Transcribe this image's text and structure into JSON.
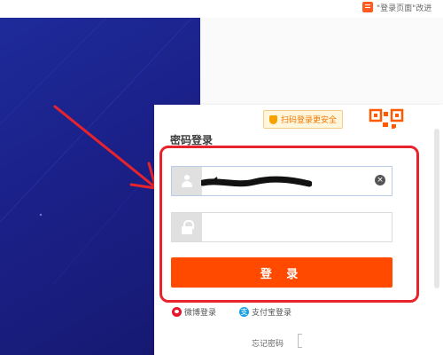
{
  "header": {
    "feedback_text": "\"登录页面\"改进"
  },
  "login": {
    "title": "密码登录",
    "qr_tip": "扫码登录更安全",
    "username_value": "",
    "password_value": "",
    "clear_symbol": "×",
    "submit_label": "登 录",
    "alt_logins": {
      "weibo": "微博登录",
      "alipay": "支付宝登录"
    },
    "forgot_password": "忘记密码"
  },
  "colors": {
    "primary_button": "#ff4a00",
    "hero_background": "#1b218a",
    "annotation_red": "#e8232b",
    "qr_tip_text": "#f07800"
  },
  "icons": [
    "feedback-icon",
    "shield-icon",
    "qr-code-icon",
    "user-icon",
    "lock-icon",
    "clear-icon",
    "weibo-icon",
    "alipay-icon",
    "annotation-arrow"
  ]
}
